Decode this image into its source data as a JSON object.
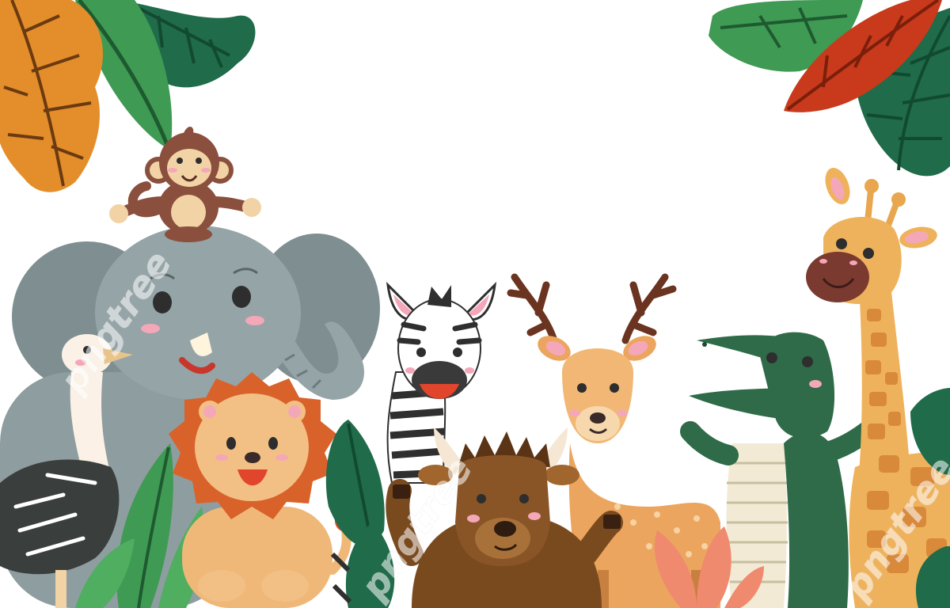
{
  "scene": {
    "description_free": true,
    "background": "#ffffff",
    "watermark_text": "pngtree",
    "palette": {
      "elephant": "#8e9da0",
      "lion": "#f0b878",
      "mane": "#d9622b",
      "zebra_stripe": "#2f2f2f",
      "deer": "#eca55e",
      "antler": "#6b3420",
      "crocodile": "#2f6b48",
      "giraffe": "#efb25c",
      "giraffe_spot": "#d9893a",
      "monkey": "#8a4f3d",
      "ostrich": "#3a3f3e",
      "bison": "#7a4a1f",
      "leaf_green": "#3f9a53",
      "leaf_dark": "#1f6b4a",
      "leaf_orange": "#e48d2b",
      "leaf_red": "#c83a1b",
      "leaf_coral": "#f08a6e"
    },
    "animals": [
      "monkey",
      "elephant",
      "ostrich",
      "lion",
      "zebra",
      "bison",
      "deer",
      "crocodile",
      "giraffe"
    ]
  }
}
